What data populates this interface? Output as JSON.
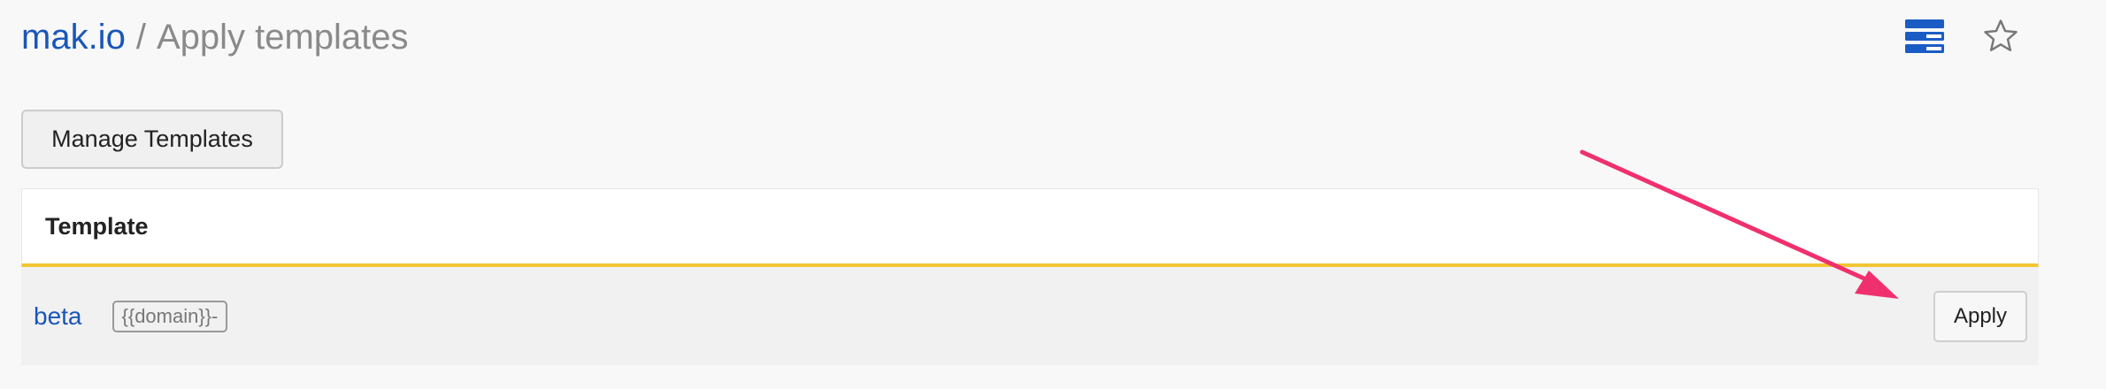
{
  "breadcrumb": {
    "site": "mak.io",
    "separator": "/",
    "current": "Apply templates"
  },
  "toolbar": {
    "layout_icon": "stacked-layout-icon",
    "star_icon": "star-outline-icon"
  },
  "manage_button": {
    "label": "Manage Templates"
  },
  "table": {
    "header": "Template",
    "rows": [
      {
        "name": "beta",
        "tag": "{{domain}}-",
        "action": "Apply"
      }
    ]
  },
  "annotation": {
    "arrow_color": "#f0306e"
  },
  "colors": {
    "link": "#1a56b8",
    "header_underline": "#f2c533",
    "icon_blue": "#1b5cc4"
  }
}
